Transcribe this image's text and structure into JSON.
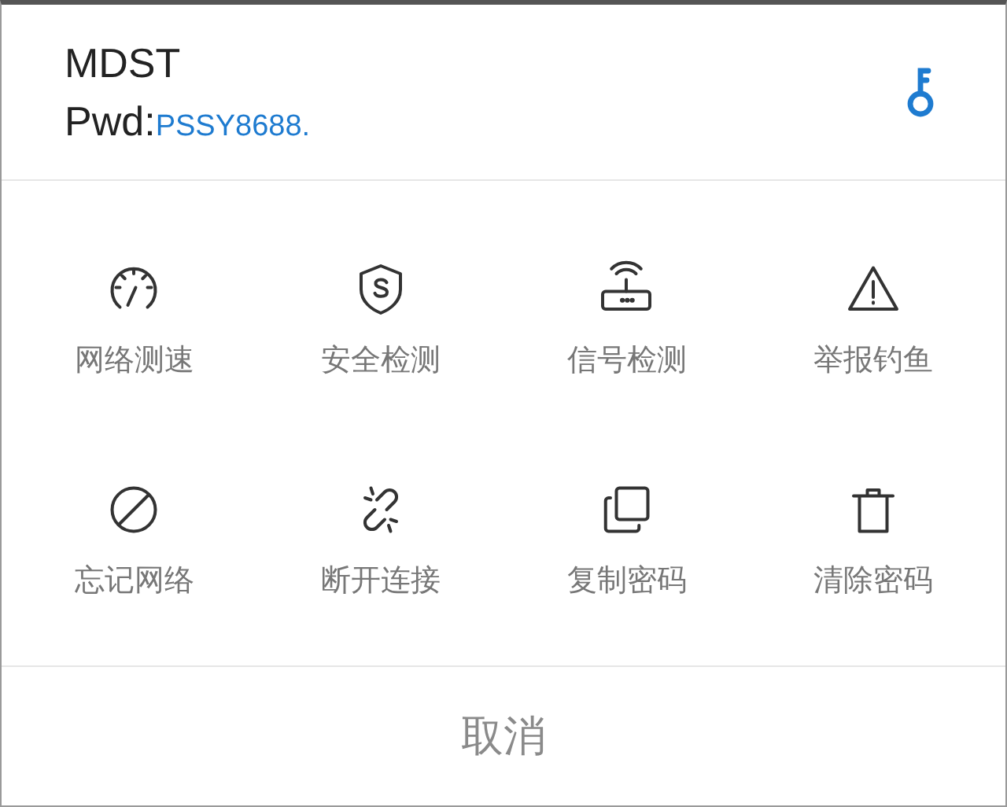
{
  "network": {
    "name": "MDST",
    "password_label": "Pwd:",
    "password": "PSSY8688."
  },
  "actions": [
    {
      "label": "网络测速",
      "kind": "speed"
    },
    {
      "label": "安全检测",
      "kind": "shield"
    },
    {
      "label": "信号检测",
      "kind": "router"
    },
    {
      "label": "举报钓鱼",
      "kind": "warning"
    },
    {
      "label": "忘记网络",
      "kind": "forbid"
    },
    {
      "label": "断开连接",
      "kind": "unlink"
    },
    {
      "label": "复制密码",
      "kind": "copy"
    },
    {
      "label": "清除密码",
      "kind": "trash"
    }
  ],
  "cancel": "取消"
}
